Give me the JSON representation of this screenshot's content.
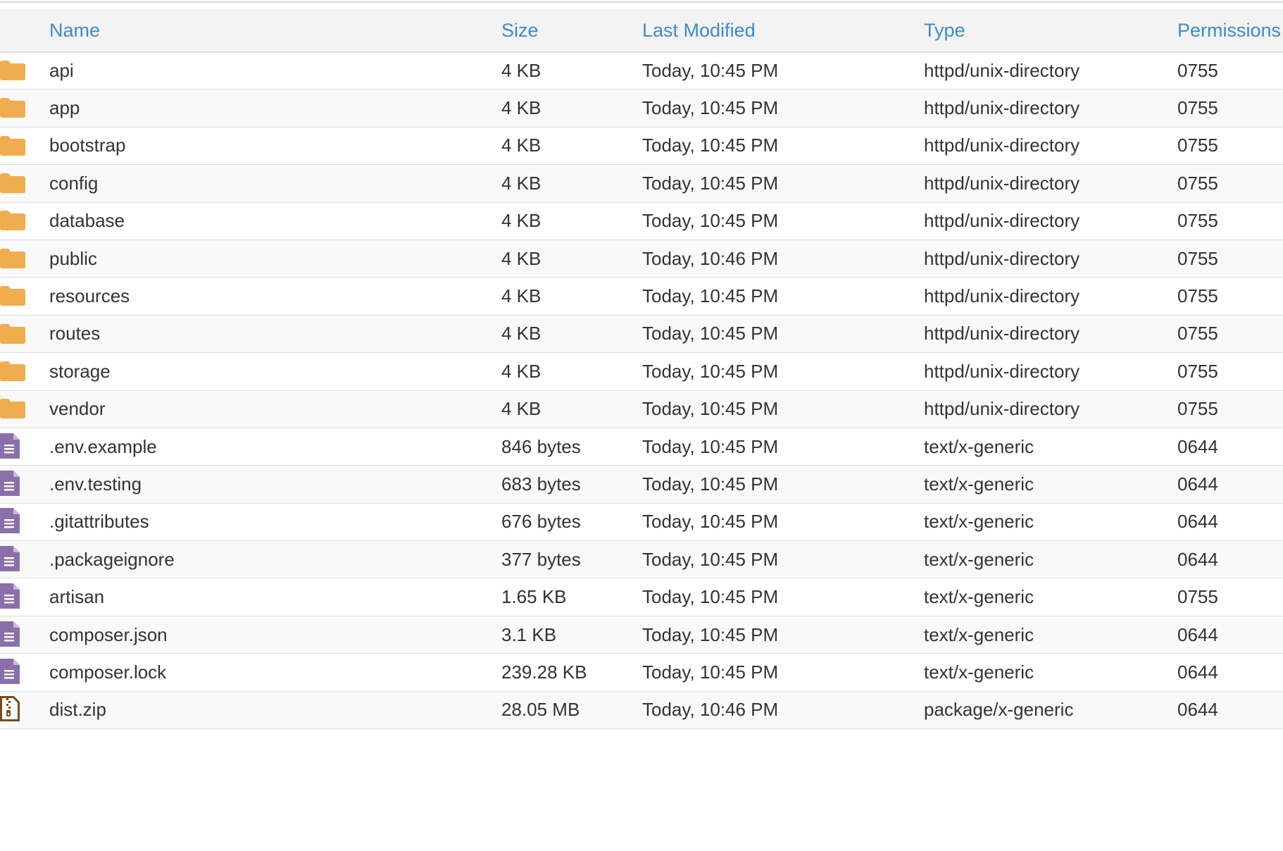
{
  "colors": {
    "header_link": "#3d8bc9",
    "folder_icon": "#f0ad4e",
    "file_icon": "#8a6fa8",
    "zip_icon": "#7a4a1f"
  },
  "table": {
    "headers": {
      "name": "Name",
      "size": "Size",
      "modified": "Last Modified",
      "type": "Type",
      "permissions": "Permissions"
    },
    "rows": [
      {
        "icon": "folder-icon",
        "name": "api",
        "size": "4 KB",
        "modified": "Today, 10:45 PM",
        "type": "httpd/unix-directory",
        "permissions": "0755"
      },
      {
        "icon": "folder-icon",
        "name": "app",
        "size": "4 KB",
        "modified": "Today, 10:45 PM",
        "type": "httpd/unix-directory",
        "permissions": "0755"
      },
      {
        "icon": "folder-icon",
        "name": "bootstrap",
        "size": "4 KB",
        "modified": "Today, 10:45 PM",
        "type": "httpd/unix-directory",
        "permissions": "0755"
      },
      {
        "icon": "folder-icon",
        "name": "config",
        "size": "4 KB",
        "modified": "Today, 10:45 PM",
        "type": "httpd/unix-directory",
        "permissions": "0755"
      },
      {
        "icon": "folder-icon",
        "name": "database",
        "size": "4 KB",
        "modified": "Today, 10:45 PM",
        "type": "httpd/unix-directory",
        "permissions": "0755"
      },
      {
        "icon": "folder-icon",
        "name": "public",
        "size": "4 KB",
        "modified": "Today, 10:46 PM",
        "type": "httpd/unix-directory",
        "permissions": "0755"
      },
      {
        "icon": "folder-icon",
        "name": "resources",
        "size": "4 KB",
        "modified": "Today, 10:45 PM",
        "type": "httpd/unix-directory",
        "permissions": "0755"
      },
      {
        "icon": "folder-icon",
        "name": "routes",
        "size": "4 KB",
        "modified": "Today, 10:45 PM",
        "type": "httpd/unix-directory",
        "permissions": "0755"
      },
      {
        "icon": "folder-icon",
        "name": "storage",
        "size": "4 KB",
        "modified": "Today, 10:45 PM",
        "type": "httpd/unix-directory",
        "permissions": "0755"
      },
      {
        "icon": "folder-icon",
        "name": "vendor",
        "size": "4 KB",
        "modified": "Today, 10:45 PM",
        "type": "httpd/unix-directory",
        "permissions": "0755"
      },
      {
        "icon": "text-file-icon",
        "name": ".env.example",
        "size": "846 bytes",
        "modified": "Today, 10:45 PM",
        "type": "text/x-generic",
        "permissions": "0644"
      },
      {
        "icon": "text-file-icon",
        "name": ".env.testing",
        "size": "683 bytes",
        "modified": "Today, 10:45 PM",
        "type": "text/x-generic",
        "permissions": "0644"
      },
      {
        "icon": "text-file-icon",
        "name": ".gitattributes",
        "size": "676 bytes",
        "modified": "Today, 10:45 PM",
        "type": "text/x-generic",
        "permissions": "0644"
      },
      {
        "icon": "text-file-icon",
        "name": ".packageignore",
        "size": "377 bytes",
        "modified": "Today, 10:45 PM",
        "type": "text/x-generic",
        "permissions": "0644"
      },
      {
        "icon": "text-file-icon",
        "name": "artisan",
        "size": "1.65 KB",
        "modified": "Today, 10:45 PM",
        "type": "text/x-generic",
        "permissions": "0755"
      },
      {
        "icon": "text-file-icon",
        "name": "composer.json",
        "size": "3.1 KB",
        "modified": "Today, 10:45 PM",
        "type": "text/x-generic",
        "permissions": "0644"
      },
      {
        "icon": "text-file-icon",
        "name": "composer.lock",
        "size": "239.28 KB",
        "modified": "Today, 10:45 PM",
        "type": "text/x-generic",
        "permissions": "0644"
      },
      {
        "icon": "zip-file-icon",
        "name": "dist.zip",
        "size": "28.05 MB",
        "modified": "Today, 10:46 PM",
        "type": "package/x-generic",
        "permissions": "0644"
      }
    ]
  }
}
